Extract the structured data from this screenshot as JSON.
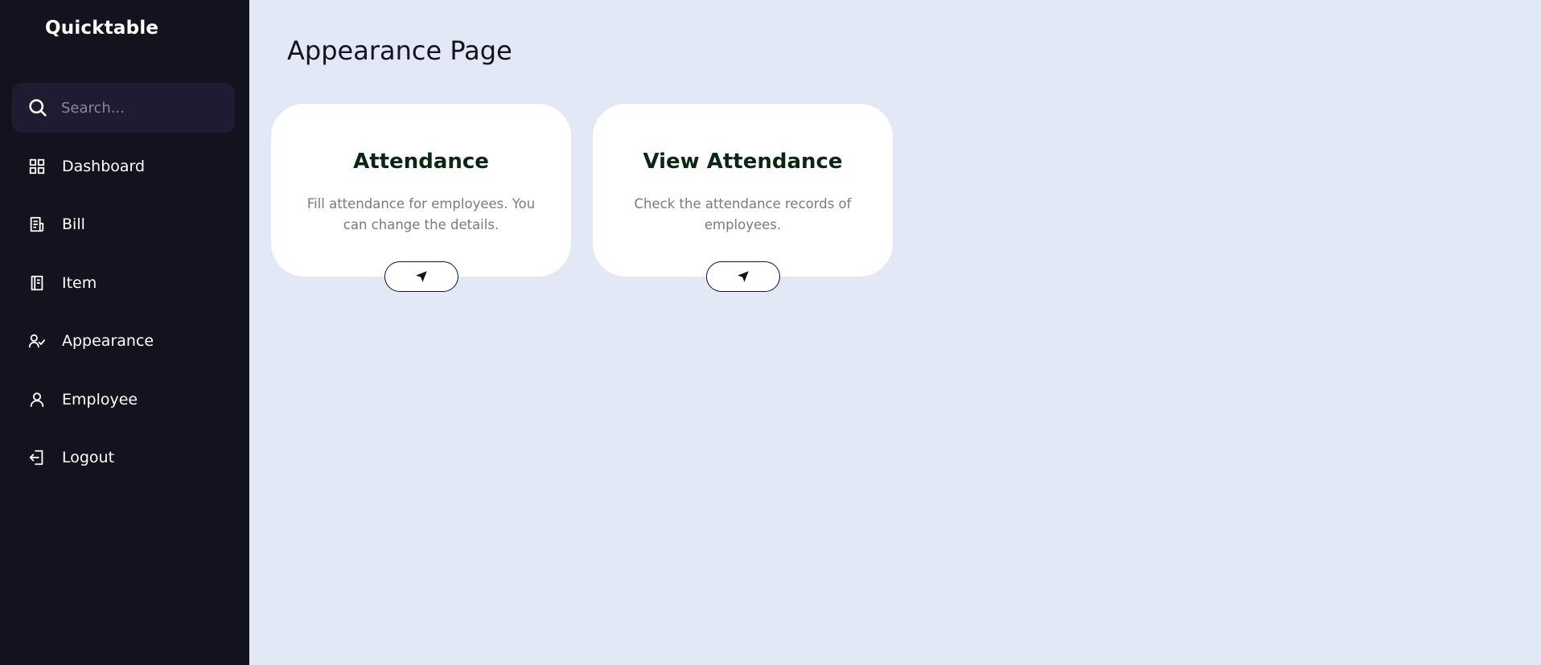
{
  "sidebar": {
    "brand": "Quicktable",
    "search": {
      "placeholder": "Search..."
    },
    "items": [
      {
        "label": "Dashboard",
        "icon": "dashboard-grid-icon"
      },
      {
        "label": "Bill",
        "icon": "bill-receipt-icon"
      },
      {
        "label": "Item",
        "icon": "item-book-icon"
      },
      {
        "label": "Appearance",
        "icon": "user-check-icon"
      },
      {
        "label": "Employee",
        "icon": "user-icon"
      },
      {
        "label": "Logout",
        "icon": "logout-icon"
      }
    ]
  },
  "main": {
    "title": "Appearance Page",
    "cards": [
      {
        "title": "Attendance",
        "description": "Fill attendance for employees. You can change the details.",
        "button_icon": "send-arrow-icon"
      },
      {
        "title": "View Attendance",
        "description": "Check the attendance records of employees.",
        "button_icon": "send-arrow-icon"
      }
    ]
  },
  "colors": {
    "sidebar_bg": "#13121f",
    "search_bg": "#1e1c33",
    "page_bg": "#e3e8f6",
    "card_bg": "#ffffff",
    "card_title": "#0b2613",
    "card_text": "#7a7a7a"
  }
}
